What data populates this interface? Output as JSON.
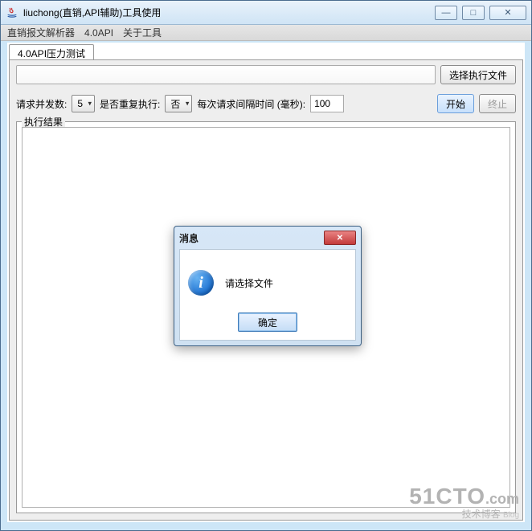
{
  "window": {
    "title": "liuchong(直销,API辅助)工具使用",
    "buttons": {
      "minimize": "—",
      "maximize": "□",
      "close": "✕"
    }
  },
  "menu": {
    "items": [
      "直销报文解析器",
      "4.0API",
      "关于工具"
    ]
  },
  "tab": {
    "label": "4.0API压力测试"
  },
  "toolbar": {
    "choose_file": "选择执行文件",
    "concurrency_label": "请求并发数:",
    "concurrency_value": "5",
    "repeat_label": "是否重复执行:",
    "repeat_value": "否",
    "interval_label": "每次请求间隔时间 (毫秒):",
    "interval_value": "100",
    "start": "开始",
    "stop": "终止"
  },
  "results": {
    "group_label": "执行结果"
  },
  "dialog": {
    "title": "消息",
    "message": "请选择文件",
    "ok": "确定",
    "close": "✕"
  },
  "watermark": {
    "brand": "51CTO",
    "domain": ".com",
    "sub": "技术博客",
    "blog": "Blog"
  }
}
